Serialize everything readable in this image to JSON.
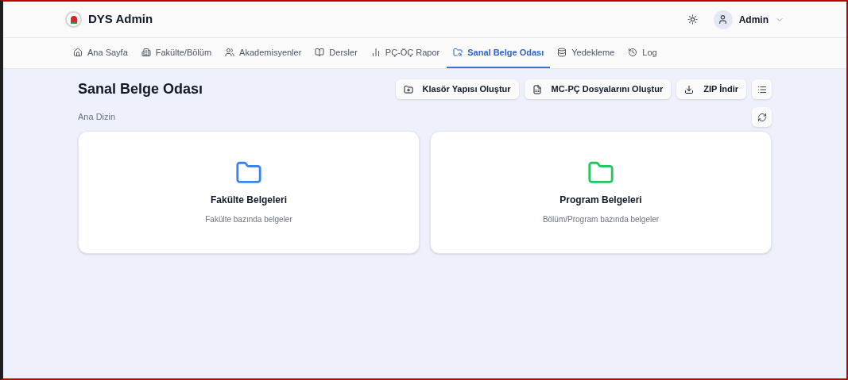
{
  "header": {
    "brand": "DYS Admin",
    "user": "Admin"
  },
  "tabs": [
    {
      "label": "Ana Sayfa",
      "selected": false
    },
    {
      "label": "Fakülte/Bölüm",
      "selected": false
    },
    {
      "label": "Akademisyenler",
      "selected": false
    },
    {
      "label": "Dersler",
      "selected": false
    },
    {
      "label": "PÇ-ÖÇ Rapor",
      "selected": false
    },
    {
      "label": "Sanal Belge Odası",
      "selected": true
    },
    {
      "label": "Yedekleme",
      "selected": false
    },
    {
      "label": "Log",
      "selected": false
    }
  ],
  "page": {
    "title": "Sanal Belge Odası",
    "breadcrumb": "Ana Dizin",
    "actions": [
      "Klasör Yapısı Oluştur",
      "MC-PÇ Dosyalarını Oluştur",
      "ZIP İndir"
    ]
  },
  "folders": [
    {
      "title": "Fakülte Belgeleri",
      "subtitle": "Fakülte bazında belgeler",
      "color": "#3b82f6"
    },
    {
      "title": "Program Belgeleri",
      "subtitle": "Bölüm/Program bazında belgeler",
      "color": "#22c55e"
    }
  ]
}
